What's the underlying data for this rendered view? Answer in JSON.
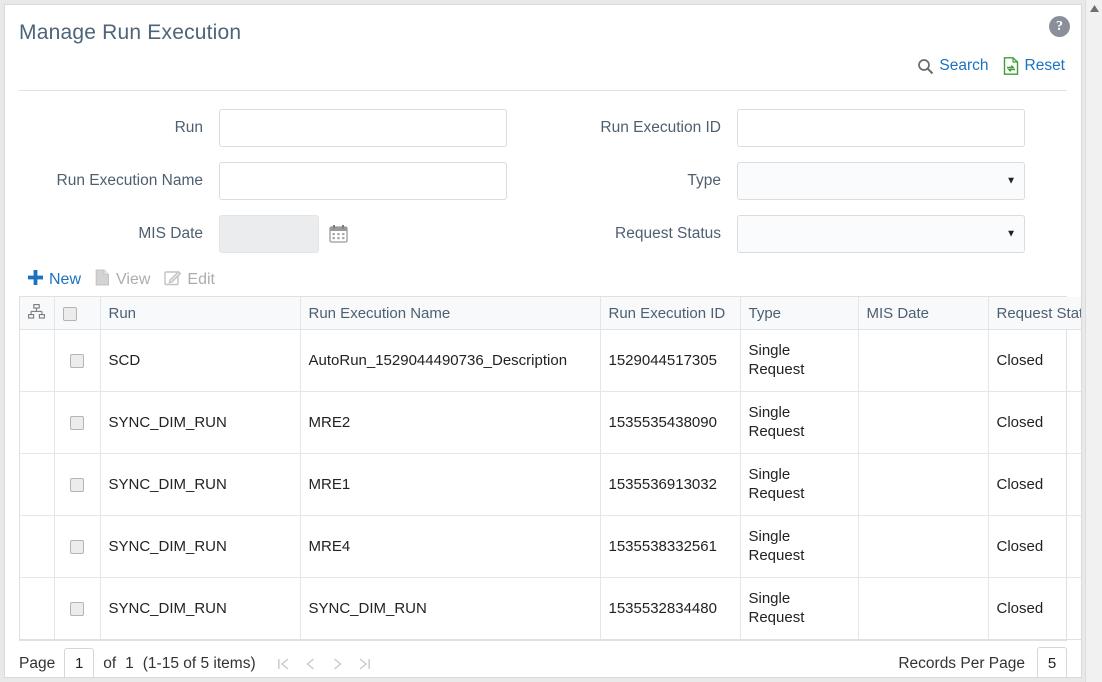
{
  "header": {
    "title": "Manage Run Execution",
    "help_icon": "help-question-icon",
    "help_label": "?"
  },
  "actions": {
    "search_label": "Search",
    "search_icon": "search-magnifier-icon",
    "reset_label": "Reset",
    "reset_icon": "reset-page-icon"
  },
  "search_form": {
    "fields": [
      {
        "label": "Run",
        "value": "",
        "placeholder": "",
        "type": "text"
      },
      {
        "label": "Run Execution Name",
        "value": "",
        "placeholder": "",
        "type": "text"
      },
      {
        "label": "MIS Date",
        "value": "",
        "placeholder": "",
        "type": "text-disabled",
        "icon": "calendar-icon"
      },
      {
        "label": "Run Execution ID",
        "value": "",
        "placeholder": "",
        "type": "text"
      },
      {
        "label": "Type",
        "value": "",
        "placeholder": "",
        "type": "select"
      },
      {
        "label": "Request Status",
        "value": "",
        "placeholder": "",
        "type": "select"
      }
    ]
  },
  "toolbar": {
    "new_label": "New",
    "new_icon": "plus-icon",
    "view_label": "View",
    "view_icon": "document-view-icon",
    "edit_label": "Edit",
    "edit_icon": "pencil-edit-icon"
  },
  "table": {
    "tree_icon": "hierarchy-tree-icon",
    "select_all_icon": "checkbox-icon",
    "columns": [
      "Run",
      "Run Execution Name",
      "Run Execution ID",
      "Type",
      "MIS Date",
      "Request Status"
    ],
    "rows": [
      {
        "run": "SCD",
        "run_execution_name": "AutoRun_1529044490736_Description",
        "run_execution_id": "1529044517305",
        "type": "Single Request",
        "mis_date": "",
        "request_status": "Closed"
      },
      {
        "run": "SYNC_DIM_RUN",
        "run_execution_name": "MRE2",
        "run_execution_id": "1535535438090",
        "type": "Single Request",
        "mis_date": "",
        "request_status": "Closed"
      },
      {
        "run": "SYNC_DIM_RUN",
        "run_execution_name": "MRE1",
        "run_execution_id": "1535536913032",
        "type": "Single Request",
        "mis_date": "",
        "request_status": "Closed"
      },
      {
        "run": "SYNC_DIM_RUN",
        "run_execution_name": "MRE4",
        "run_execution_id": "1535538332561",
        "type": "Single Request",
        "mis_date": "",
        "request_status": "Closed"
      },
      {
        "run": "SYNC_DIM_RUN",
        "run_execution_name": "SYNC_DIM_RUN",
        "run_execution_id": "1535532834480",
        "type": "Single Request",
        "mis_date": "",
        "request_status": "Closed"
      }
    ]
  },
  "pagination": {
    "page_label": "Page",
    "page_value": "1",
    "of_label": "of",
    "total_pages": "1",
    "items_summary": "(1-15 of  5 items)",
    "first_icon": "first-page-icon",
    "prev_icon": "previous-page-icon",
    "next_icon": "next-page-icon",
    "last_icon": "last-page-icon",
    "records_per_page_label": "Records Per Page",
    "records_per_page_value": "5"
  },
  "colors": {
    "title": "#4d6479",
    "link": "#1b72c0",
    "label": "#4e5f70",
    "header_bg": "#f7f9fb",
    "reset_green": "#3f9c35",
    "disabled": "#adadad"
  }
}
